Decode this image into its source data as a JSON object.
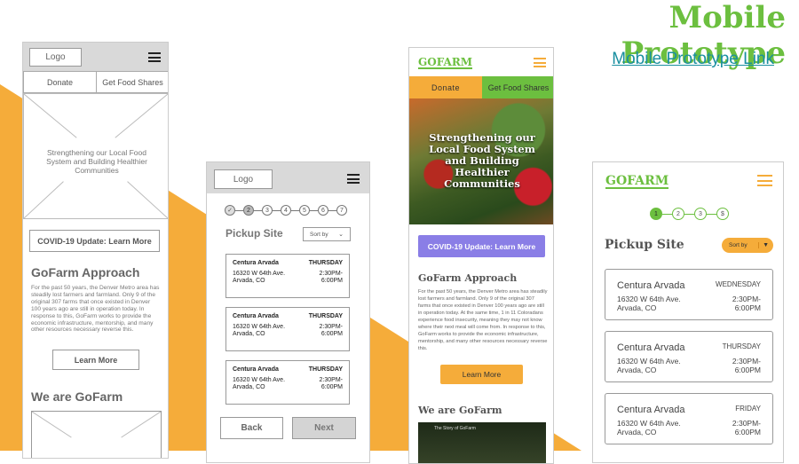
{
  "slide": {
    "title": "Mobile Prototype",
    "link": "Mobile Prototype Link",
    "colors": {
      "accent_orange": "#f5ac3a",
      "brand_green": "#6cbf3f",
      "covid_purple": "#8a7ee6",
      "link_teal": "#1a8fa0"
    }
  },
  "wireframe_home": {
    "logo": "Logo",
    "nav": [
      "Donate",
      "Get Food Shares"
    ],
    "hero": "Strengthening our Local Food System and Building Healthier Communities",
    "covid": "COVID-19 Update: Learn More",
    "approach_title": "GoFarm Approach",
    "approach_text": "For the past 50 years, the Denver Metro area has steadily lost farmers and farmland. Only 9 of the original 307 farms that once existed in Denver 100 years ago are still in operation today. In response to this, GoFarm works to provide the economic infrastructure, mentorship, and many other resources necessary reverse this.",
    "learn_more": "Learn More",
    "we_are": "We are GoFarm"
  },
  "wireframe_pickup": {
    "logo": "Logo",
    "steps": [
      "✓",
      "2",
      "3",
      "4",
      "5",
      "6",
      "7"
    ],
    "title": "Pickup Site",
    "sort": "Sort by",
    "sites": [
      {
        "name": "Centura Arvada",
        "day": "THURSDAY",
        "address1": "16320 W 64th Ave.",
        "address2": "Arvada, CO",
        "time1": "2:30PM-",
        "time2": "6:00PM"
      },
      {
        "name": "Centura Arvada",
        "day": "THURSDAY",
        "address1": "16320 W 64th Ave.",
        "address2": "Arvada, CO",
        "time1": "2:30PM-",
        "time2": "6:00PM"
      },
      {
        "name": "Centura Arvada",
        "day": "THURSDAY",
        "address1": "16320 W 64th Ave.",
        "address2": "Arvada, CO",
        "time1": "2:30PM-",
        "time2": "6:00PM"
      }
    ],
    "back": "Back",
    "next": "Next"
  },
  "mock_home": {
    "logo": "GOFARM",
    "nav": [
      "Donate",
      "Get Food Shares"
    ],
    "hero": "Strengthening our Local Food System and Building Healthier Communities",
    "covid": "COVID-19 Update: Learn More",
    "approach_title": "GoFarm Approach",
    "approach_text": "For the past 50 years, the Denver Metro area has steadily lost farmers and farmland. Only 9 of the original 307 farms that once existed in Denver 100 years ago are still in operation today. At the same time, 1 in 11 Coloradans experience food insecurity, meaning they may not know where their next meal will come from. In response to this, GoFarm works to provide the economic infrastructure, mentorship, and many other resources necessary reverse this.",
    "learn_more": "Learn More",
    "we_are": "We are GoFarm",
    "video_title": "The Story of GoFarm"
  },
  "mock_pickup": {
    "logo": "GOFARM",
    "steps": [
      "1",
      "2",
      "3",
      "$"
    ],
    "title": "Pickup Site",
    "sort": "Sort by",
    "sites": [
      {
        "name": "Centura Arvada",
        "day": "WEDNESDAY",
        "address1": "16320 W 64th Ave.",
        "address2": "Arvada, CO",
        "time1": "2:30PM-",
        "time2": "6:00PM"
      },
      {
        "name": "Centura Arvada",
        "day": "THURSDAY",
        "address1": "16320 W 64th Ave.",
        "address2": "Arvada, CO",
        "time1": "2:30PM-",
        "time2": "6:00PM"
      },
      {
        "name": "Centura Arvada",
        "day": "FRIDAY",
        "address1": "16320 W 64th Ave.",
        "address2": "Arvada, CO",
        "time1": "2:30PM-",
        "time2": "6:00PM"
      }
    ]
  }
}
